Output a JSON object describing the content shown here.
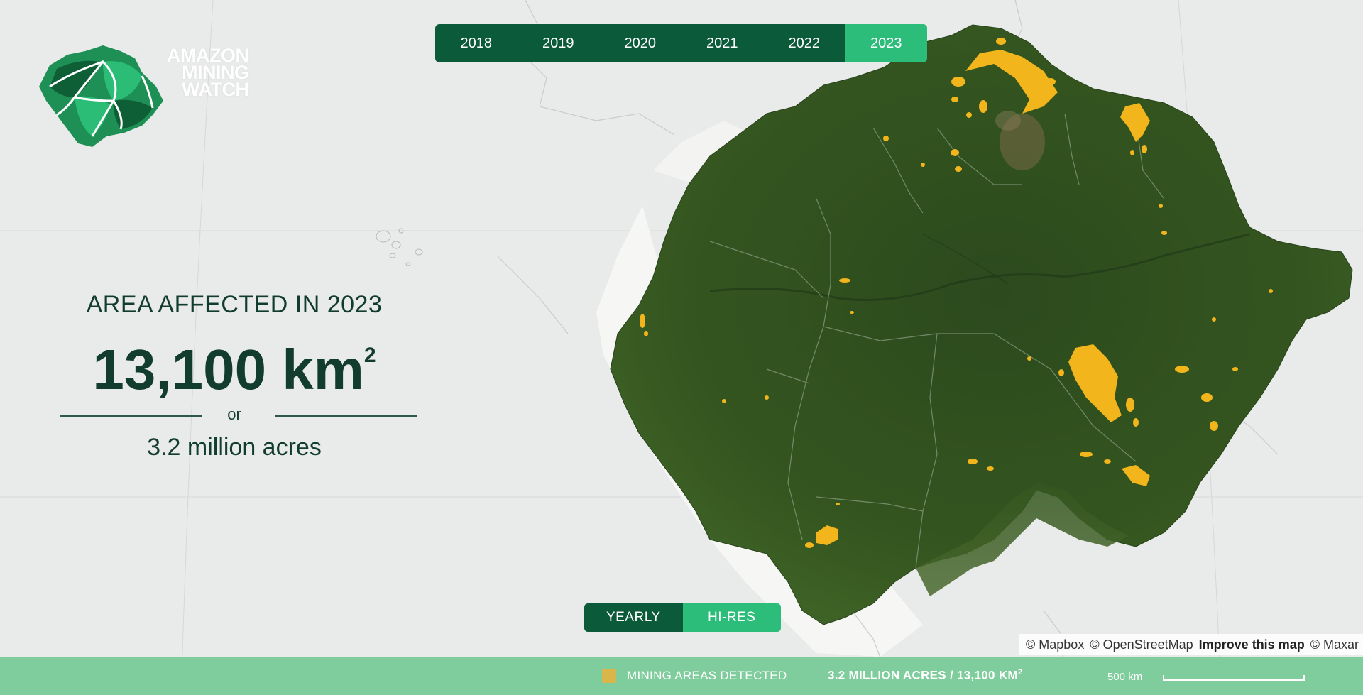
{
  "logo": {
    "lines": [
      "AMAZON",
      "MINING",
      "WATCH"
    ],
    "icon": "amazon-leaf-logo-icon"
  },
  "year_tabs": {
    "items": [
      "2018",
      "2019",
      "2020",
      "2021",
      "2022",
      "2023"
    ],
    "active": "2023"
  },
  "stats": {
    "heading": "AREA AFFECTED IN 2023",
    "value": "13,100 km",
    "value_superscript": "2",
    "or": "or",
    "acres": "3.2 million acres"
  },
  "mode_toggle": {
    "yearly": "YEARLY",
    "hires": "HI-RES",
    "active": "YEARLY"
  },
  "attribution": {
    "mapbox": "© Mapbox",
    "osm": "© OpenStreetMap",
    "improve": "Improve this map",
    "maxar": "© Maxar"
  },
  "legend": {
    "swatch_color": "#d8b64a",
    "label": "MINING AREAS DETECTED",
    "total": "3.2 MILLION ACRES / 13,100 KM",
    "total_superscript": "2",
    "scale_label": "500 km"
  },
  "colors": {
    "dark_green": "#0b5a3a",
    "accent_green": "#2dbd7a",
    "forest": "#2f4f22",
    "mining": "#f2b61c",
    "legend_bar": "#7fcc9c"
  }
}
